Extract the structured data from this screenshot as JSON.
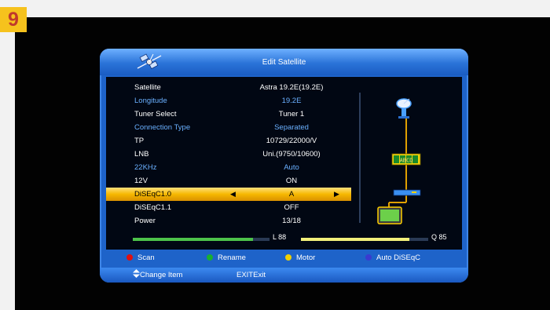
{
  "step_number": "9",
  "dialog": {
    "title": "Edit Satellite"
  },
  "settings": [
    {
      "label": "Satellite",
      "value": "Astra 19.2E(19.2E)"
    },
    {
      "label": "Longitude",
      "value": "19.2E"
    },
    {
      "label": "Tuner Select",
      "value": "Tuner 1"
    },
    {
      "label": "Connection Type",
      "value": "Separated"
    },
    {
      "label": "TP",
      "value": "10729/22000/V"
    },
    {
      "label": "LNB",
      "value": "Uni.(9750/10600)"
    },
    {
      "label": "22KHz",
      "value": "Auto"
    },
    {
      "label": "12V",
      "value": "ON"
    },
    {
      "label": "DiSEqC1.0",
      "value": "A",
      "selected": true
    },
    {
      "label": "DiSEqC1.1",
      "value": "OFF"
    },
    {
      "label": "Power",
      "value": "13/18"
    }
  ],
  "arrows": {
    "left": "◀",
    "right": "▶"
  },
  "diagram": {
    "switch_label": "ABCD",
    "icons": [
      "satellite-dish-icon",
      "diseqc-switch-icon",
      "receiver-icon",
      "tv-icon"
    ]
  },
  "signal": {
    "level_label": "L 88",
    "level": 0.88,
    "quality_label": "Q 85",
    "quality": 0.85
  },
  "color_keys": [
    {
      "color": "#e01010",
      "label": "Scan"
    },
    {
      "color": "#18b030",
      "label": "Rename"
    },
    {
      "color": "#f0d000",
      "label": "Motor"
    },
    {
      "color": "#3a3ad0",
      "label": "Auto DiSEqC"
    }
  ],
  "nav": {
    "change_item": "Change Item",
    "exit_key": "EXIT",
    "exit_label": "Exit"
  },
  "colors": {
    "dialog_blue": "#1e63c9",
    "highlight": "#f6b800",
    "accent_text": "#6ab0ff",
    "level_bar": "#4cc24a",
    "quality_bar": "#f2f07a",
    "badge": "#f6c21d"
  }
}
